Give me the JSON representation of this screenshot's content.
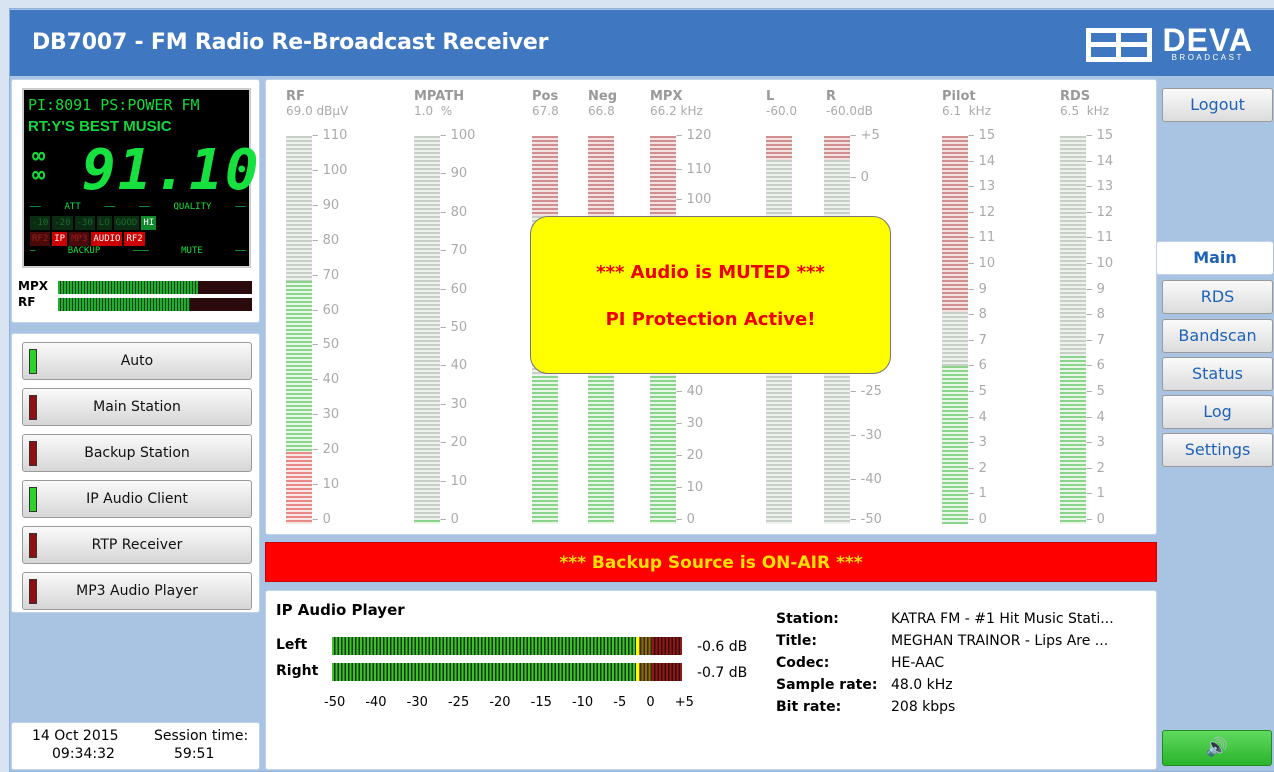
{
  "app_title": "DB7007 - FM Radio Re-Broadcast Receiver",
  "logo": {
    "name": "DEVA",
    "sub": "BROADCAST"
  },
  "lcd": {
    "line1": "PI:8091 PS:POWER  FM",
    "line2": "RT:Y'S BEST MUSIC",
    "freq": "91.10",
    "att_label": "ATT",
    "quality_label": "QUALITY",
    "att_cells": [
      "-10",
      "-20",
      "-30"
    ],
    "quality_cells": [
      "LO",
      "GOOD",
      "HI"
    ],
    "backup_label": "BACKUP",
    "mute_label": "MUTE",
    "backup_cells": [
      "RF2",
      "IP",
      "MP3"
    ],
    "mute_cells": [
      "AUDIO",
      "RF2"
    ],
    "mpx_label": "MPX",
    "rf_label": "RF",
    "mpx_level": 0.72,
    "rf_level": 0.68
  },
  "sources": [
    {
      "label": "Auto",
      "state": "green"
    },
    {
      "label": "Main Station",
      "state": "red"
    },
    {
      "label": "Backup Station",
      "state": "red"
    },
    {
      "label": "IP Audio Client",
      "state": "green"
    },
    {
      "label": "RTP Receiver",
      "state": "red"
    },
    {
      "label": "MP3 Audio Player",
      "state": "red"
    }
  ],
  "datetime": {
    "date": "14 Oct 2015",
    "time": "09:34:32",
    "session_label": "Session time:",
    "session": "59:51"
  },
  "meters": {
    "rf": {
      "label": "RF",
      "value": "69.0",
      "unit": "dBµV",
      "ticks": [
        "110",
        "100",
        "90",
        "80",
        "70",
        "60",
        "50",
        "40",
        "30",
        "20",
        "10",
        "0"
      ],
      "level": 0.627
    },
    "mpath": {
      "label": "MPATH",
      "value": "1.0",
      "unit": "%",
      "ticks": [
        "100",
        "90",
        "80",
        "70",
        "60",
        "50",
        "40",
        "30",
        "20",
        "10",
        "0"
      ],
      "level": 0.01
    },
    "pos": {
      "label": "Pos",
      "value": "67.8"
    },
    "neg": {
      "label": "Neg",
      "value": "66.8"
    },
    "mpx": {
      "label": "MPX",
      "value": "66.2",
      "unit": "kHz",
      "ticks": [
        "120",
        "110",
        "100",
        "40",
        "30",
        "20",
        "10",
        "0"
      ]
    },
    "l": {
      "label": "L",
      "value": "-60.0"
    },
    "r": {
      "label": "R",
      "value": "-60.0",
      "unit": "dB",
      "ticks": [
        "+5",
        "0",
        "-25",
        "-30",
        "-40",
        "-50"
      ]
    },
    "pilot": {
      "label": "Pilot",
      "value": "6.1",
      "unit": "kHz",
      "ticks": [
        "15",
        "14",
        "13",
        "12",
        "11",
        "10",
        "9",
        "8",
        "7",
        "6",
        "5",
        "4",
        "3",
        "2",
        "1",
        "0"
      ],
      "level": 0.407
    },
    "rds": {
      "label": "RDS",
      "value": "6.5",
      "unit": "kHz",
      "ticks": [
        "15",
        "14",
        "13",
        "12",
        "11",
        "10",
        "9",
        "8",
        "7",
        "6",
        "5",
        "4",
        "3",
        "2",
        "1",
        "0"
      ],
      "level": 0.433
    }
  },
  "popup": {
    "line1": "*** Audio is MUTED ***",
    "line2": "PI Protection Active!"
  },
  "onair": "***   Backup Source is ON-AIR  ***",
  "player": {
    "title": "IP Audio Player",
    "left_label": "Left",
    "right_label": "Right",
    "left_db": "-0.6 dB",
    "right_db": "-0.7 dB",
    "scale": [
      "-50",
      "-40",
      "-30",
      "-25",
      "-20",
      "-15",
      "-10",
      "-5",
      "0",
      "+5"
    ],
    "info": [
      {
        "k": "Station:",
        "v": "KATRA FM - #1 Hit Music Stati..."
      },
      {
        "k": "Title:",
        "v": "MEGHAN TRAINOR - Lips Are ..."
      },
      {
        "k": "Codec:",
        "v": "HE-AAC"
      },
      {
        "k": "Sample rate:",
        "v": "48.0 kHz"
      },
      {
        "k": "Bit rate:",
        "v": "208 kbps"
      }
    ]
  },
  "nav": {
    "logout": "Logout",
    "items": [
      "Main",
      "RDS",
      "Bandscan",
      "Status",
      "Log",
      "Settings"
    ],
    "active": "Main"
  },
  "speaker_icon": "speaker-icon"
}
